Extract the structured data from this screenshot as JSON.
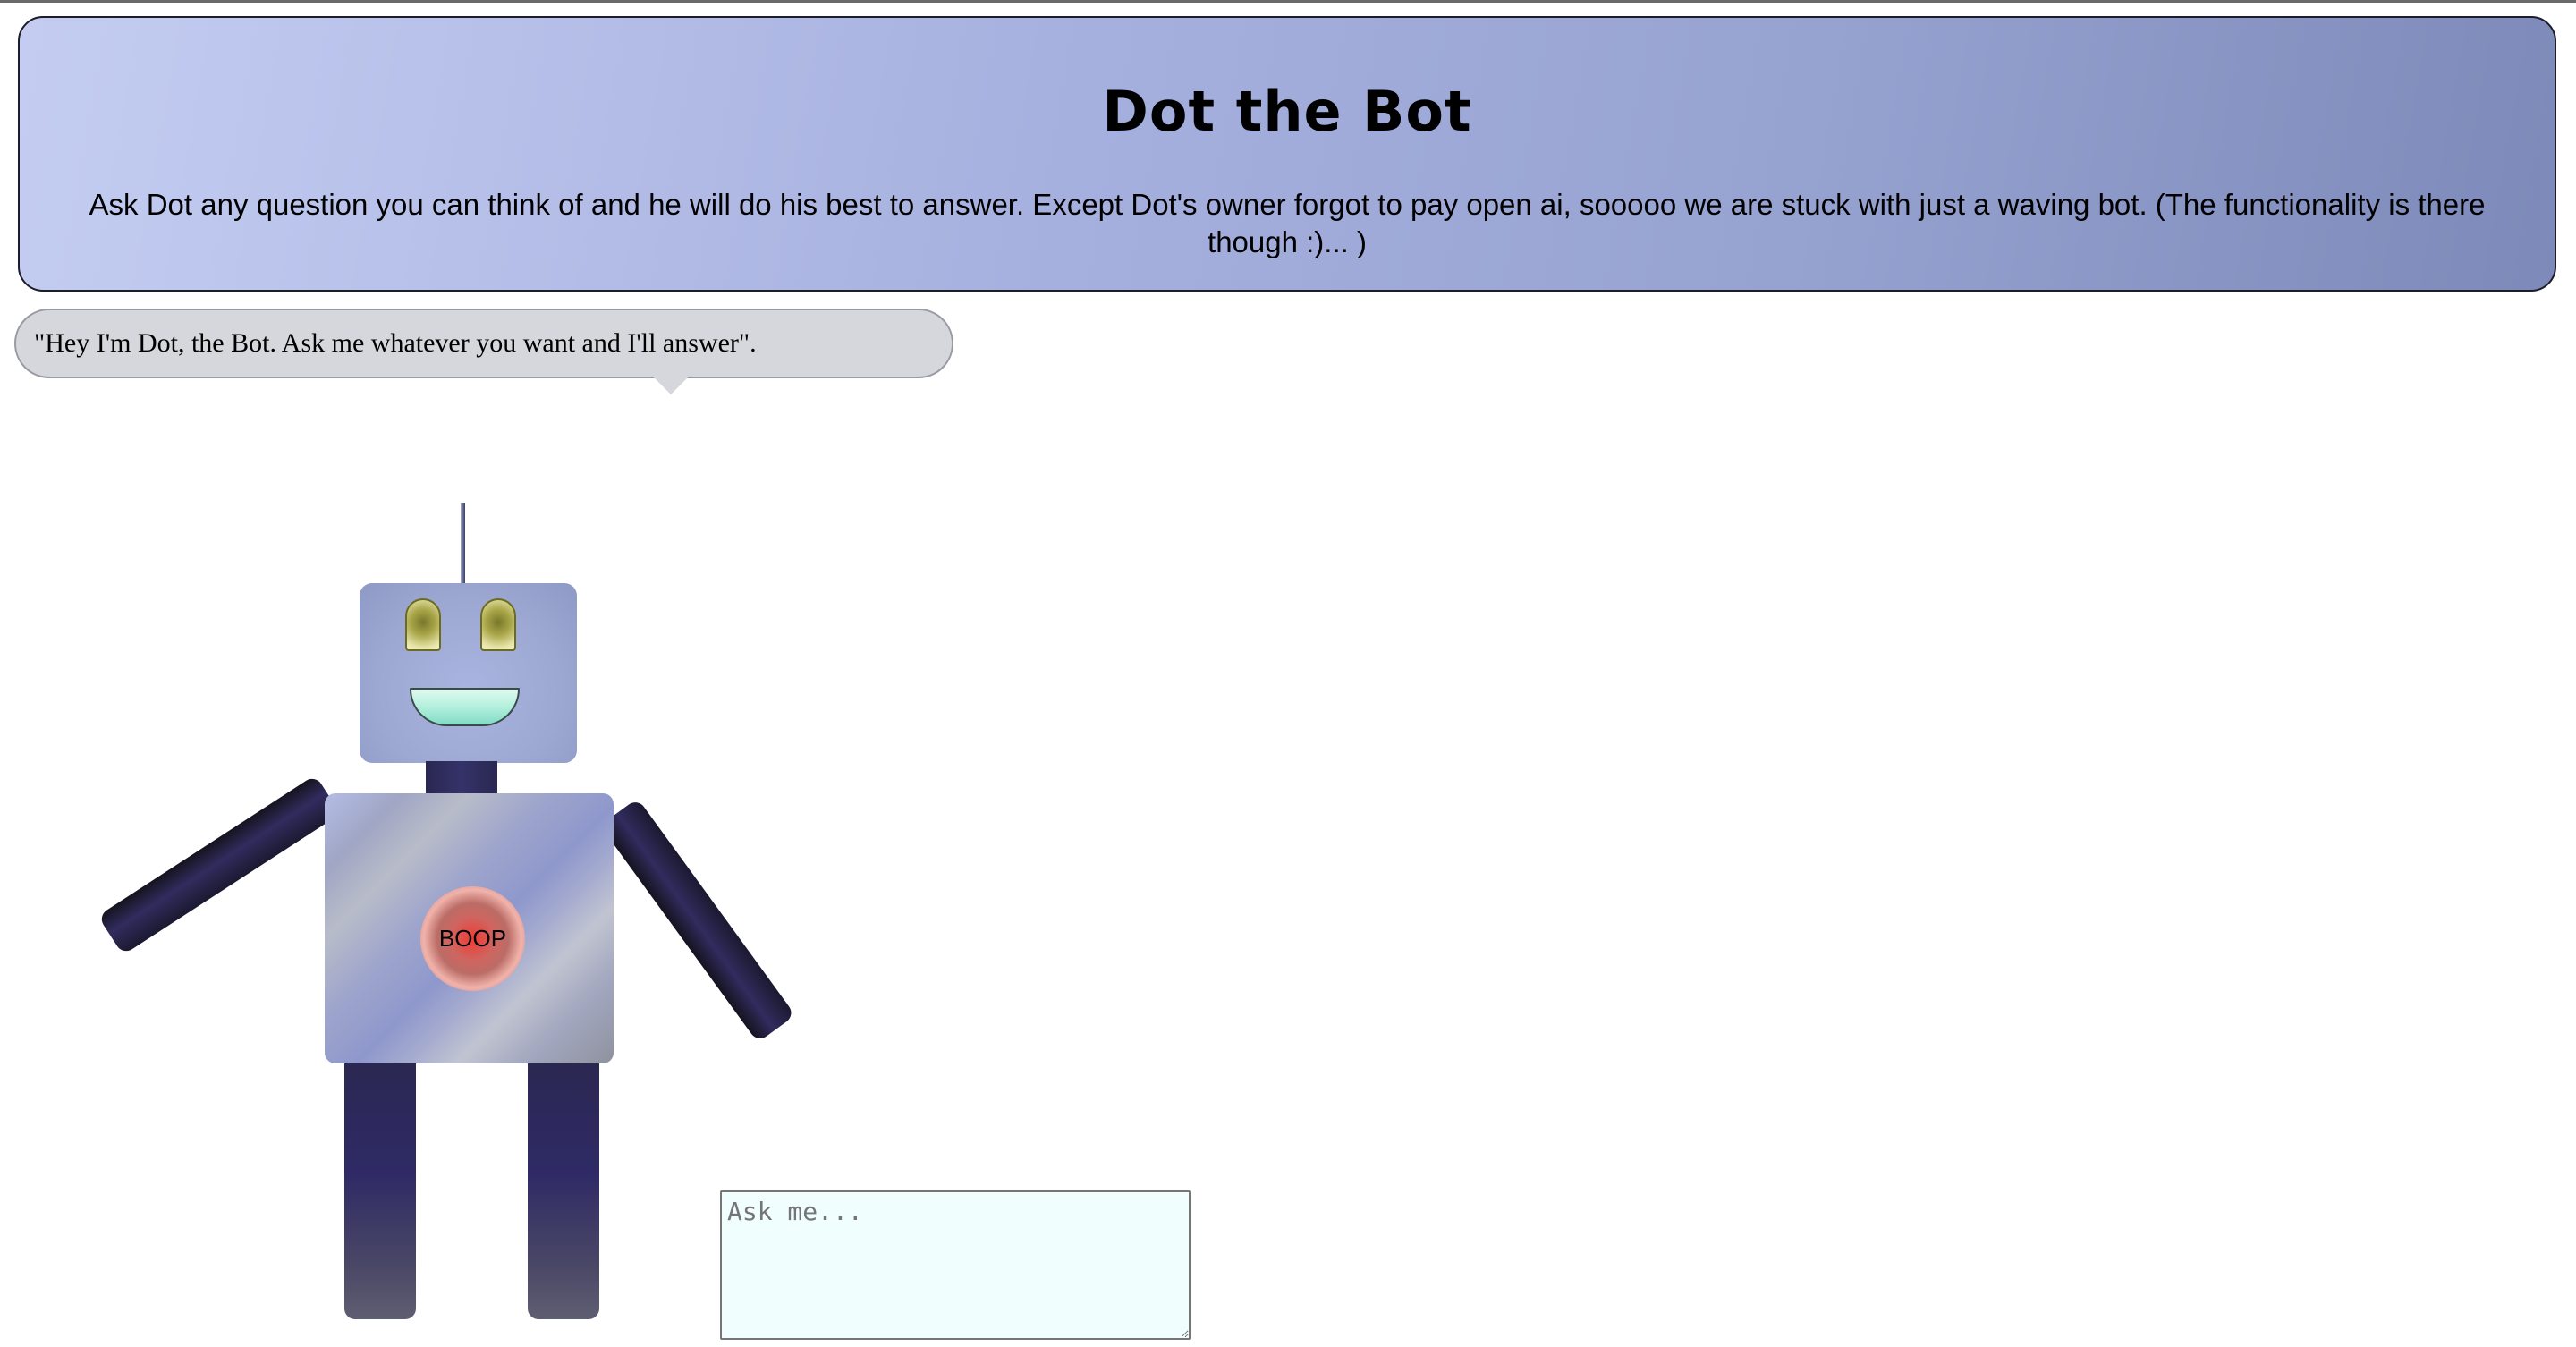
{
  "header": {
    "title": "Dot the Bot",
    "description": "Ask Dot any question you can think of and he will do his best to answer. Except Dot's owner forgot to pay open ai, sooooo we are stuck with just a waving bot. (The functionality is there though :)... )"
  },
  "speech": {
    "text": "\"Hey I'm Dot, the Bot. Ask me whatever you want and I'll answer\"."
  },
  "robot": {
    "button_label": "BOOP"
  },
  "ask": {
    "placeholder": "Ask me...",
    "value": ""
  },
  "colors": {
    "header_gradient_start": "#c4cdf1",
    "header_gradient_end": "#7d8ab9",
    "bubble_bg": "#d6d7dc",
    "textarea_bg": "#f0fefe",
    "boop_red": "#ef3b35"
  }
}
